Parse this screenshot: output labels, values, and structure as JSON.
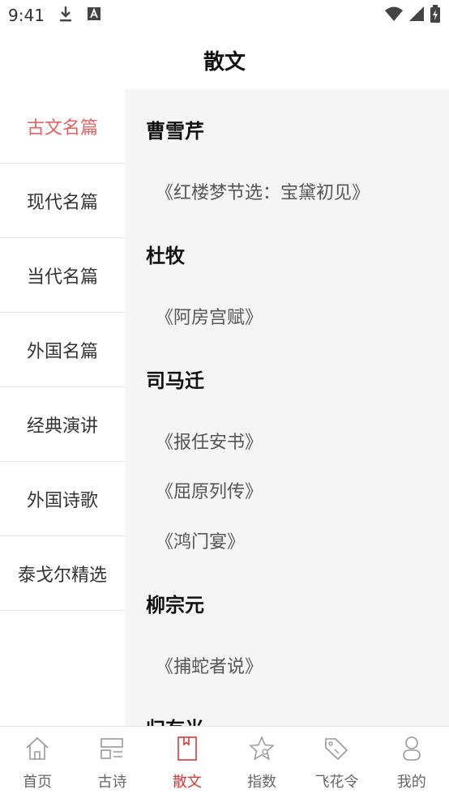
{
  "status_bar": {
    "time": "9:41",
    "icons": [
      "download-icon",
      "a-icon",
      "wifi-icon",
      "signal-icon",
      "battery-icon"
    ]
  },
  "header": {
    "title": "散文"
  },
  "sidebar": {
    "items": [
      {
        "label": "古文名篇",
        "active": true
      },
      {
        "label": "现代名篇",
        "active": false
      },
      {
        "label": "当代名篇",
        "active": false
      },
      {
        "label": "外国名篇",
        "active": false
      },
      {
        "label": "经典演讲",
        "active": false
      },
      {
        "label": "外国诗歌",
        "active": false
      },
      {
        "label": "泰戈尔精选",
        "active": false
      }
    ]
  },
  "content": {
    "sections": [
      {
        "author": "曹雪芹",
        "works": [
          "《红楼梦节选：宝黛初见》"
        ]
      },
      {
        "author": "杜牧",
        "works": [
          "《阿房宫赋》"
        ]
      },
      {
        "author": "司马迁",
        "works": [
          "《报任安书》",
          "《屈原列传》",
          "《鸿门宴》"
        ]
      },
      {
        "author": "柳宗元",
        "works": [
          "《捕蛇者说》"
        ]
      },
      {
        "author": "归有光",
        "works": []
      }
    ]
  },
  "tab_bar": {
    "tabs": [
      {
        "label": "首页",
        "icon": "home-icon",
        "active": false
      },
      {
        "label": "古诗",
        "icon": "grid-icon",
        "active": false
      },
      {
        "label": "散文",
        "icon": "bookmark-icon",
        "active": true
      },
      {
        "label": "指数",
        "icon": "star-icon",
        "active": false
      },
      {
        "label": "飞花令",
        "icon": "tag-icon",
        "active": false
      },
      {
        "label": "我的",
        "icon": "user-icon",
        "active": false
      }
    ]
  },
  "colors": {
    "accent": "#d93a36",
    "sidebar_active": "#e8605f",
    "content_bg": "#f5f5f5"
  }
}
